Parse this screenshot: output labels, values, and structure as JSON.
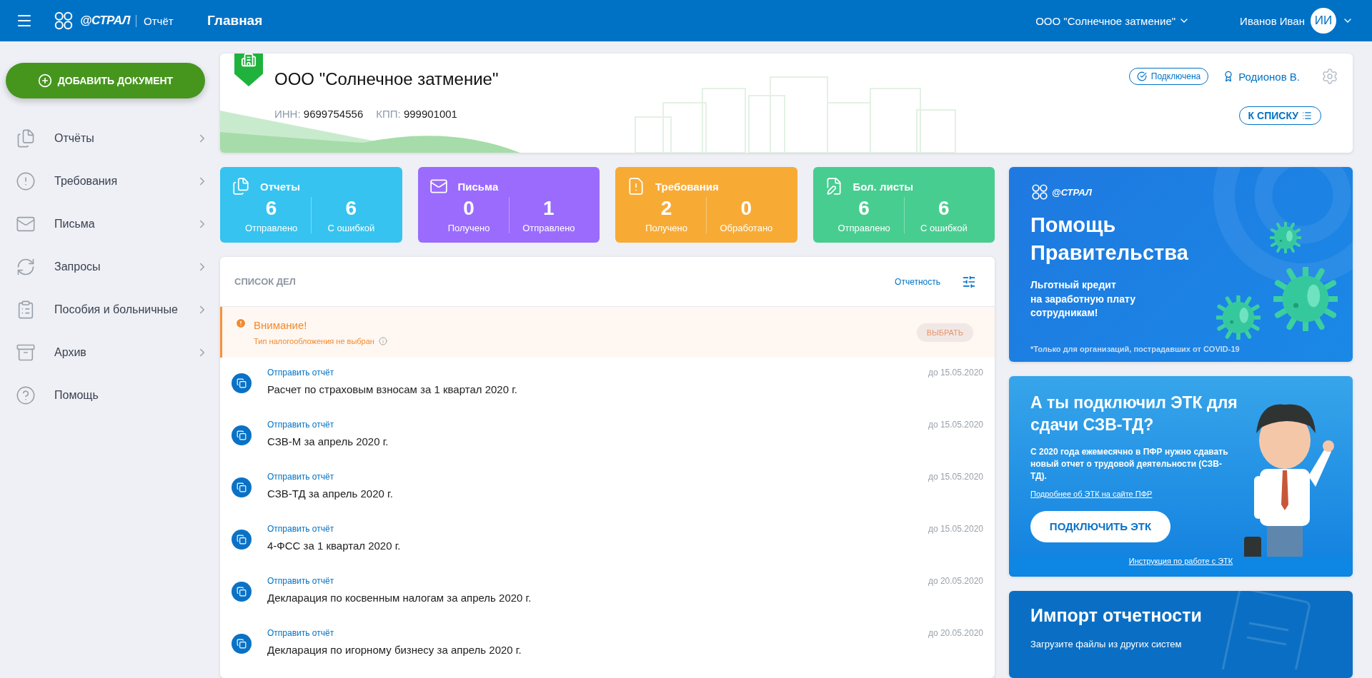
{
  "header": {
    "brand": "@СТРАЛ",
    "app_name": "Отчёт",
    "page_title": "Главная",
    "organization": "ООО \"Солнечное затмение\"",
    "user": "Иванов Иван",
    "avatar_initials": "ИИ"
  },
  "sidebar": {
    "add_button": "ДОБАВИТЬ ДОКУМЕНТ",
    "items": [
      {
        "label": "Отчёты",
        "has_arrow": true
      },
      {
        "label": "Требования",
        "has_arrow": true
      },
      {
        "label": "Письма",
        "has_arrow": true
      },
      {
        "label": "Запросы",
        "has_arrow": true
      },
      {
        "label": "Пособия и больничные",
        "has_arrow": true
      },
      {
        "label": "Архив",
        "has_arrow": true
      },
      {
        "label": "Помощь",
        "has_arrow": false
      }
    ]
  },
  "company": {
    "name": "ООО \"Солнечное затмение\"",
    "inn_label": "ИНН:",
    "inn": "9699754556",
    "kpp_label": "КПП:",
    "kpp": "999901001",
    "status": "Подключена",
    "signer": "Родионов В.",
    "list_button": "К СПИСКУ"
  },
  "stats": [
    {
      "title": "Отчеты",
      "color": "#36c3ef",
      "items": [
        {
          "value": "6",
          "label": "Отправлено"
        },
        {
          "value": "6",
          "label": "С ошибкой"
        }
      ]
    },
    {
      "title": "Письма",
      "color": "#9b6bfe",
      "items": [
        {
          "value": "0",
          "label": "Получено"
        },
        {
          "value": "1",
          "label": "Отправлено"
        }
      ]
    },
    {
      "title": "Требования",
      "color": "#f7ab35",
      "items": [
        {
          "value": "2",
          "label": "Получено"
        },
        {
          "value": "0",
          "label": "Обработано"
        }
      ]
    },
    {
      "title": "Бол. листы",
      "color": "#47cd90",
      "items": [
        {
          "value": "6",
          "label": "Отправлено"
        },
        {
          "value": "6",
          "label": "С ошибкой"
        }
      ]
    }
  ],
  "todo": {
    "title": "СПИСОК ДЕЛ",
    "filter": "Отчетность",
    "warning": {
      "title": "Внимание!",
      "text": "Тип налогообложения не выбран",
      "button": "ВЫБРАТЬ"
    },
    "items": [
      {
        "action": "Отправить отчёт",
        "name": "Расчет по страховым взносам за 1 квартал 2020 г.",
        "deadline": "до 15.05.2020"
      },
      {
        "action": "Отправить отчёт",
        "name": "СЗВ-М за апрель 2020 г.",
        "deadline": "до 15.05.2020"
      },
      {
        "action": "Отправить отчёт",
        "name": "СЗВ-ТД за апрель 2020 г.",
        "deadline": "до 15.05.2020"
      },
      {
        "action": "Отправить отчёт",
        "name": "4-ФСС за 1 квартал 2020 г.",
        "deadline": "до 15.05.2020"
      },
      {
        "action": "Отправить отчёт",
        "name": "Декларация по косвенным налогам за апрель 2020 г.",
        "deadline": "до 20.05.2020"
      },
      {
        "action": "Отправить отчёт",
        "name": "Декларация по игорному бизнесу за апрель 2020 г.",
        "deadline": "до 20.05.2020"
      }
    ]
  },
  "promos": [
    {
      "kind": "covid",
      "brand": "@СТРАЛ",
      "title": "Помощь Правительства",
      "text": "Льготный кредит\nна заработную плату\nсотрудникам!",
      "note": "*Только для организаций, пострадавших от COVID-19"
    },
    {
      "kind": "etk",
      "title": "А ты подключил ЭТК для сдачи СЗВ-ТД?",
      "text": "С 2020 года ежемесячно в ПФР нужно сдавать новый отчет о трудовой деятельности (СЗВ-ТД).",
      "link": "Подробнее об ЭТК на сайте ПФР",
      "button": "ПОДКЛЮЧИТЬ ЭТК",
      "footer_link": "Инструкция по работе с ЭТК"
    },
    {
      "kind": "import",
      "title": "Импорт отчетности",
      "text": "Загрузите файлы из других систем"
    }
  ]
}
